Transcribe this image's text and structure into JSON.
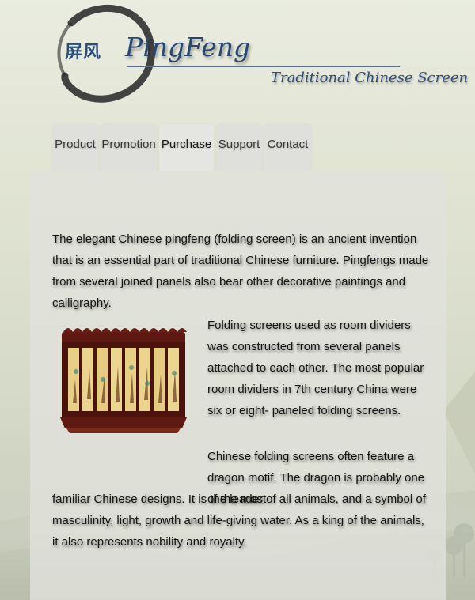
{
  "header": {
    "logo_chars": "屏风",
    "brand_name": "PingFeng",
    "tagline": "Traditional Chinese Screen"
  },
  "nav": {
    "tabs": [
      {
        "label": "Product",
        "active": false
      },
      {
        "label": "Promotion",
        "active": false
      },
      {
        "label": "Purchase",
        "active": true
      },
      {
        "label": "Support",
        "active": false
      },
      {
        "label": "Contact",
        "active": false
      }
    ]
  },
  "content": {
    "intro": "The elegant Chinese pingfeng (folding screen) is an ancient invention that is an essential part of traditional Chinese furniture. Pingfengs made from several joined panels also bear other decorative paintings and calligraphy.",
    "room_dividers": "Folding screens used as room dividers was constructed from several panels attached to each other. The most popular room dividers in 7th century China were six or eight- paneled folding screens.",
    "dragon_start": "Chinese folding screens often feature a dragon motif. The dragon is probably one of the most",
    "dragon_rest": "familiar Chinese designs. It is the leader of all animals, and a symbol of masculinity, light, growth and life-giving water. As a king of the animals, it also represents nobility and royalty."
  },
  "colors": {
    "brand": "#274876",
    "screen_frame": "#6b1f14",
    "screen_panel": "#e8cf86"
  }
}
